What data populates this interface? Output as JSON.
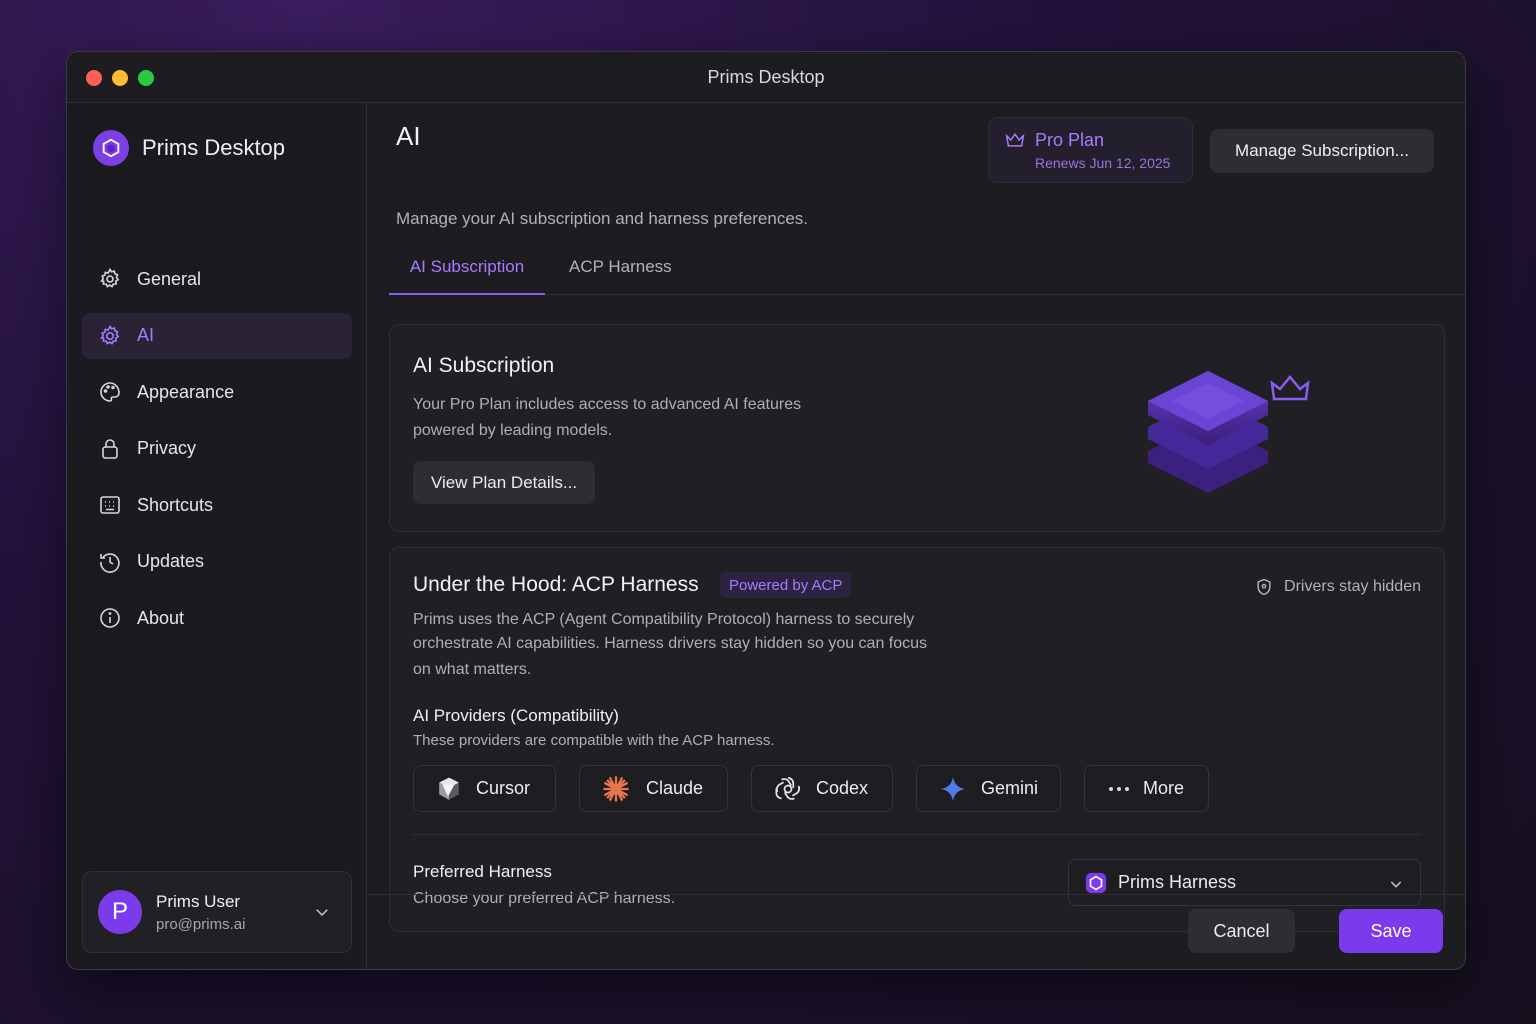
{
  "window": {
    "title": "Prims Desktop"
  },
  "sidebar": {
    "brand": "Prims Desktop",
    "items": [
      {
        "label": "General",
        "icon": "gear-icon"
      },
      {
        "label": "AI",
        "icon": "ai-icon",
        "active": true
      },
      {
        "label": "Appearance",
        "icon": "palette-icon"
      },
      {
        "label": "Privacy",
        "icon": "lock-icon"
      },
      {
        "label": "Shortcuts",
        "icon": "keyboard-icon"
      },
      {
        "label": "Updates",
        "icon": "clock-icon"
      },
      {
        "label": "About",
        "icon": "info-icon"
      }
    ],
    "user": {
      "initial": "P",
      "name": "Prims User",
      "email": "pro@prims.ai"
    }
  },
  "header": {
    "title": "AI",
    "subtitle": "Manage your AI subscription and harness preferences.",
    "plan_name": "Pro Plan",
    "plan_renew": "Renews Jun 12, 2025",
    "manage_label": "Manage Subscription..."
  },
  "tabs": [
    {
      "label": "AI Subscription",
      "active": true
    },
    {
      "label": "ACP Harness",
      "active": false
    }
  ],
  "subscription_card": {
    "title": "AI Subscription",
    "description_line1": "Your Pro Plan includes access to advanced AI features",
    "description_line2": "powered by leading models.",
    "button_label": "View Plan Details..."
  },
  "harness_card": {
    "title": "Under the Hood: ACP Harness",
    "badge": "Powered by ACP",
    "note": "Drivers stay hidden",
    "description_line1": "Prims uses the ACP (Agent Compatibility Protocol) harness to securely",
    "description_line2": "orchestrate AI capabilities. Harness drivers stay hidden so you can focus",
    "description_line3": "on what matters.",
    "providers_title": "AI Providers (Compatibility)",
    "providers_subtitle": "These providers are compatible with the ACP harness.",
    "providers": [
      {
        "label": "Cursor",
        "icon": "cursor-icon"
      },
      {
        "label": "Claude",
        "icon": "claude-icon"
      },
      {
        "label": "Codex",
        "icon": "openai-icon"
      },
      {
        "label": "Gemini",
        "icon": "gemini-icon"
      },
      {
        "label": "More",
        "icon": "more-icon"
      }
    ],
    "preferred_title": "Preferred Harness",
    "preferred_subtitle": "Choose your preferred ACP harness.",
    "preferred_value": "Prims Harness"
  },
  "footer": {
    "cancel_label": "Cancel",
    "save_label": "Save"
  },
  "colors": {
    "accent": "#7c3aed",
    "accent_text": "#a77bff"
  }
}
